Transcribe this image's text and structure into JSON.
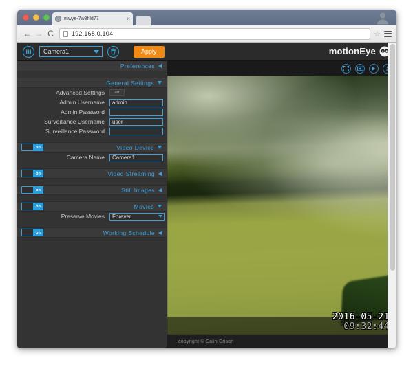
{
  "browser": {
    "tab_title": "mwye-7w8hld77",
    "tab_close_label": "×",
    "back_label": "←",
    "forward_label": "→",
    "reload_label": "C",
    "url": "192.168.0.104",
    "bookmark_star": "☆"
  },
  "app": {
    "menu_icon": "hamburger-icon",
    "camera_selected": "Camera1",
    "delete_icon": "trash-icon",
    "apply_label": "Apply",
    "brand": "motionEye",
    "brand_logo": "owl-icon"
  },
  "video": {
    "toolbar_icons": [
      "fullscreen-icon",
      "snapshot-icon",
      "play-icon",
      "wrench-icon"
    ],
    "timestamp_date": "2016-05-21",
    "timestamp_time": "09:32:44",
    "copyright": "copyright © Calin Crisan"
  },
  "settings": {
    "preferences_label": "Preferences",
    "sections": [
      {
        "id": "general-settings",
        "label": "General Settings",
        "arrow": "down",
        "has_toggle": false,
        "fields": [
          {
            "label": "Advanced Settings",
            "type": "toggle",
            "value": "off"
          },
          {
            "label": "Admin Username",
            "type": "text",
            "value": "admin"
          },
          {
            "label": "Admin Password",
            "type": "text",
            "value": ""
          },
          {
            "label": "Surveillance Username",
            "type": "text",
            "value": "user"
          },
          {
            "label": "Surveillance Password",
            "type": "text",
            "value": ""
          }
        ]
      },
      {
        "id": "video-device",
        "label": "Video Device",
        "arrow": "down",
        "has_toggle": true,
        "toggle_state": "on",
        "toggle_label": "on",
        "fields": [
          {
            "label": "Camera Name",
            "type": "text",
            "value": "Camera1"
          }
        ]
      },
      {
        "id": "video-streaming",
        "label": "Video Streaming",
        "arrow": "left",
        "has_toggle": true,
        "toggle_state": "on",
        "toggle_label": "on",
        "fields": []
      },
      {
        "id": "still-images",
        "label": "Still Images",
        "arrow": "left",
        "has_toggle": true,
        "toggle_state": "on",
        "toggle_label": "on",
        "fields": []
      },
      {
        "id": "movies",
        "label": "Movies",
        "arrow": "down",
        "has_toggle": true,
        "toggle_state": "on",
        "toggle_label": "on",
        "fields": [
          {
            "label": "Preserve Movies",
            "type": "select",
            "value": "Forever"
          }
        ]
      },
      {
        "id": "working-schedule",
        "label": "Working Schedule",
        "arrow": "left",
        "has_toggle": true,
        "toggle_state": "on",
        "toggle_label": "on",
        "fields": []
      }
    ]
  },
  "colors": {
    "accent_blue": "#3b9fde",
    "apply_orange": "#f08a14",
    "panel_bg": "#333333",
    "topbar_bg": "#2b2b2b"
  }
}
